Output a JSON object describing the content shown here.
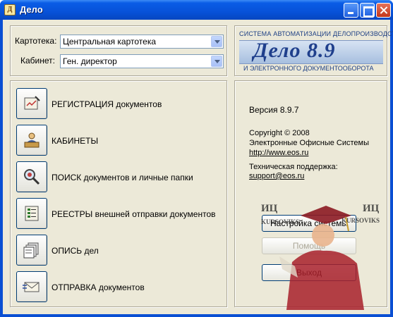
{
  "window": {
    "title": "Дело",
    "app_icon_letter": "Д"
  },
  "card_index": {
    "label": "Картотека:",
    "value": "Центральная картотека"
  },
  "cabinet": {
    "label": "Кабинет:",
    "value": "Ген. директор"
  },
  "logo": {
    "top_text": "СИСТЕМА АВТОМАТИЗАЦИИ ДЕЛОПРОИЗВОДСТВА",
    "main_text": "Дело 8.9",
    "bottom_text": "И ЭЛЕКТРОННОГО ДОКУМЕНТООБОРОТА"
  },
  "menu": [
    {
      "label": "РЕГИСТРАЦИЯ  документов",
      "icon": "document-register-icon"
    },
    {
      "label": "КАБИНЕТЫ",
      "icon": "cabinet-desk-icon"
    },
    {
      "label": "ПОИСК  документов и личные папки",
      "icon": "search-magnifier-icon"
    },
    {
      "label": "РЕЕСТРЫ  внешней отправки документов",
      "icon": "registry-list-icon"
    },
    {
      "label": "ОПИСЬ дел",
      "icon": "case-inventory-icon"
    },
    {
      "label": "ОТПРАВКА документов",
      "icon": "envelope-send-icon"
    }
  ],
  "info": {
    "version": "Версия 8.9.7",
    "copyright": "Copyright © 2008",
    "company": "Электронные Офисные Системы",
    "website": "http://www.eos.ru",
    "support_label": "Техническая поддержка:",
    "support_email": "support@eos.ru"
  },
  "buttons": {
    "settings": "Настройка системы",
    "help": "Помощь",
    "exit": "Выход"
  },
  "watermark": {
    "left_text": "ИЦ",
    "right_text": "ИЦ",
    "left_brand": "KURSOVIKS",
    "right_brand": "KURSOVIKS"
  },
  "colors": {
    "titlebar": "#0a5ce6",
    "client_bg": "#ece9d8",
    "logo_blue": "#1f3f8c"
  }
}
